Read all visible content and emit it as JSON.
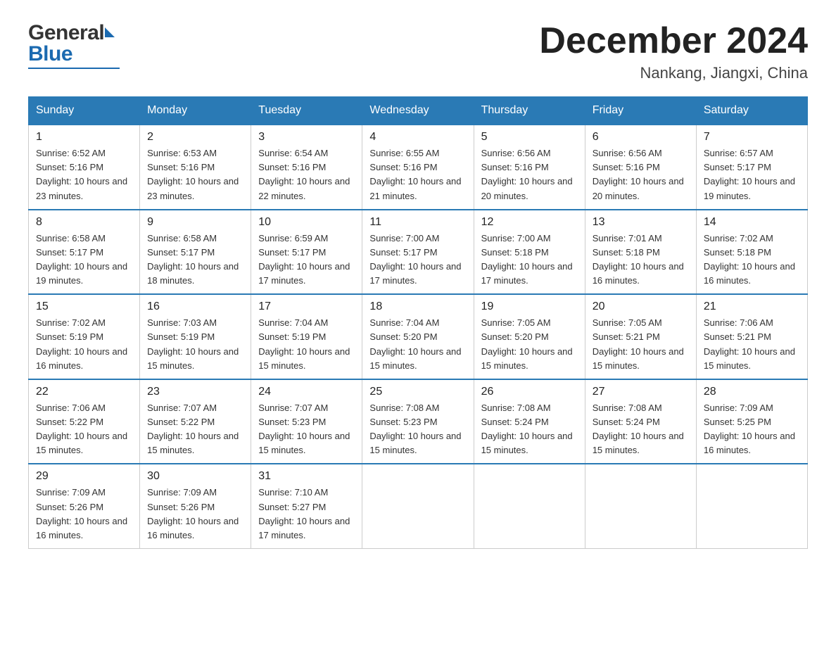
{
  "logo": {
    "text_general": "General",
    "text_blue": "Blue"
  },
  "header": {
    "month_title": "December 2024",
    "location": "Nankang, Jiangxi, China"
  },
  "days_of_week": [
    "Sunday",
    "Monday",
    "Tuesday",
    "Wednesday",
    "Thursday",
    "Friday",
    "Saturday"
  ],
  "weeks": [
    [
      {
        "day": "1",
        "sunrise": "6:52 AM",
        "sunset": "5:16 PM",
        "daylight": "10 hours and 23 minutes."
      },
      {
        "day": "2",
        "sunrise": "6:53 AM",
        "sunset": "5:16 PM",
        "daylight": "10 hours and 23 minutes."
      },
      {
        "day": "3",
        "sunrise": "6:54 AM",
        "sunset": "5:16 PM",
        "daylight": "10 hours and 22 minutes."
      },
      {
        "day": "4",
        "sunrise": "6:55 AM",
        "sunset": "5:16 PM",
        "daylight": "10 hours and 21 minutes."
      },
      {
        "day": "5",
        "sunrise": "6:56 AM",
        "sunset": "5:16 PM",
        "daylight": "10 hours and 20 minutes."
      },
      {
        "day": "6",
        "sunrise": "6:56 AM",
        "sunset": "5:16 PM",
        "daylight": "10 hours and 20 minutes."
      },
      {
        "day": "7",
        "sunrise": "6:57 AM",
        "sunset": "5:17 PM",
        "daylight": "10 hours and 19 minutes."
      }
    ],
    [
      {
        "day": "8",
        "sunrise": "6:58 AM",
        "sunset": "5:17 PM",
        "daylight": "10 hours and 19 minutes."
      },
      {
        "day": "9",
        "sunrise": "6:58 AM",
        "sunset": "5:17 PM",
        "daylight": "10 hours and 18 minutes."
      },
      {
        "day": "10",
        "sunrise": "6:59 AM",
        "sunset": "5:17 PM",
        "daylight": "10 hours and 17 minutes."
      },
      {
        "day": "11",
        "sunrise": "7:00 AM",
        "sunset": "5:17 PM",
        "daylight": "10 hours and 17 minutes."
      },
      {
        "day": "12",
        "sunrise": "7:00 AM",
        "sunset": "5:18 PM",
        "daylight": "10 hours and 17 minutes."
      },
      {
        "day": "13",
        "sunrise": "7:01 AM",
        "sunset": "5:18 PM",
        "daylight": "10 hours and 16 minutes."
      },
      {
        "day": "14",
        "sunrise": "7:02 AM",
        "sunset": "5:18 PM",
        "daylight": "10 hours and 16 minutes."
      }
    ],
    [
      {
        "day": "15",
        "sunrise": "7:02 AM",
        "sunset": "5:19 PM",
        "daylight": "10 hours and 16 minutes."
      },
      {
        "day": "16",
        "sunrise": "7:03 AM",
        "sunset": "5:19 PM",
        "daylight": "10 hours and 15 minutes."
      },
      {
        "day": "17",
        "sunrise": "7:04 AM",
        "sunset": "5:19 PM",
        "daylight": "10 hours and 15 minutes."
      },
      {
        "day": "18",
        "sunrise": "7:04 AM",
        "sunset": "5:20 PM",
        "daylight": "10 hours and 15 minutes."
      },
      {
        "day": "19",
        "sunrise": "7:05 AM",
        "sunset": "5:20 PM",
        "daylight": "10 hours and 15 minutes."
      },
      {
        "day": "20",
        "sunrise": "7:05 AM",
        "sunset": "5:21 PM",
        "daylight": "10 hours and 15 minutes."
      },
      {
        "day": "21",
        "sunrise": "7:06 AM",
        "sunset": "5:21 PM",
        "daylight": "10 hours and 15 minutes."
      }
    ],
    [
      {
        "day": "22",
        "sunrise": "7:06 AM",
        "sunset": "5:22 PM",
        "daylight": "10 hours and 15 minutes."
      },
      {
        "day": "23",
        "sunrise": "7:07 AM",
        "sunset": "5:22 PM",
        "daylight": "10 hours and 15 minutes."
      },
      {
        "day": "24",
        "sunrise": "7:07 AM",
        "sunset": "5:23 PM",
        "daylight": "10 hours and 15 minutes."
      },
      {
        "day": "25",
        "sunrise": "7:08 AM",
        "sunset": "5:23 PM",
        "daylight": "10 hours and 15 minutes."
      },
      {
        "day": "26",
        "sunrise": "7:08 AM",
        "sunset": "5:24 PM",
        "daylight": "10 hours and 15 minutes."
      },
      {
        "day": "27",
        "sunrise": "7:08 AM",
        "sunset": "5:24 PM",
        "daylight": "10 hours and 15 minutes."
      },
      {
        "day": "28",
        "sunrise": "7:09 AM",
        "sunset": "5:25 PM",
        "daylight": "10 hours and 16 minutes."
      }
    ],
    [
      {
        "day": "29",
        "sunrise": "7:09 AM",
        "sunset": "5:26 PM",
        "daylight": "10 hours and 16 minutes."
      },
      {
        "day": "30",
        "sunrise": "7:09 AM",
        "sunset": "5:26 PM",
        "daylight": "10 hours and 16 minutes."
      },
      {
        "day": "31",
        "sunrise": "7:10 AM",
        "sunset": "5:27 PM",
        "daylight": "10 hours and 17 minutes."
      },
      null,
      null,
      null,
      null
    ]
  ]
}
